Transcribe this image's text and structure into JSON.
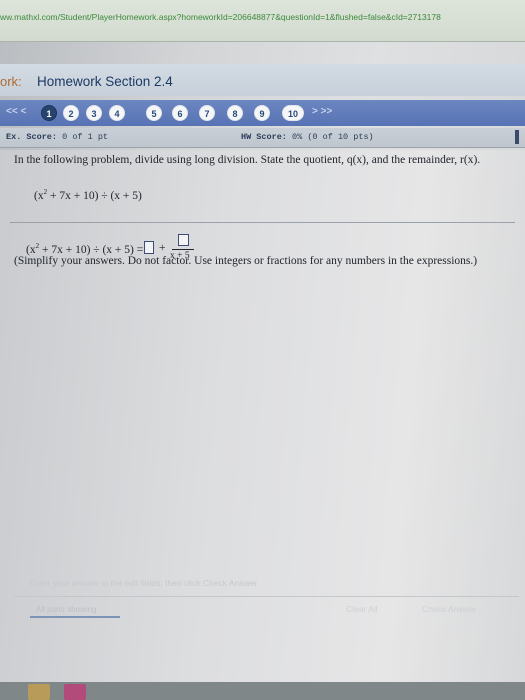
{
  "browser": {
    "url": "ww.mathxl.com/Student/PlayerHomework.aspx?homeworkId=206648877&questionId=1&flushed=false&cId=2713178"
  },
  "header": {
    "title_prefix": "ork:",
    "title": "Homework Section 2.4"
  },
  "nav": {
    "prev_label": "<<  <",
    "next_label": ">  >>",
    "questions": [
      "1",
      "2",
      "3",
      "4",
      "5",
      "6",
      "7",
      "8",
      "9",
      "10"
    ],
    "current": "1"
  },
  "scores": {
    "ex_label": "Ex. Score:",
    "ex_value": "0 of 1 pt",
    "hw_label": "HW Score:",
    "hw_value": "0% (0 of 10 pts)"
  },
  "problem": {
    "instruction": "In the following problem, divide using long division. State the quotient, q(x), and the remainder, r(x).",
    "expression_parts": [
      "(x",
      "2",
      " + 7x + 10) ÷ (x + 5)"
    ],
    "equation_parts": [
      "(x",
      "2",
      " + 7x + 10) ÷ (x + 5) ="
    ],
    "plus": "+",
    "denominator": "x + 5",
    "note": "(Simplify your answers. Do not factor. Use integers or fractions for any numbers in the expressions.)"
  },
  "footer": {
    "hint": "Enter your answer in the edit fields, then click Check Answer.",
    "status_link": "All parts showing",
    "clear_all_label": "Clear All",
    "check_answer_label": "Check Answer"
  }
}
